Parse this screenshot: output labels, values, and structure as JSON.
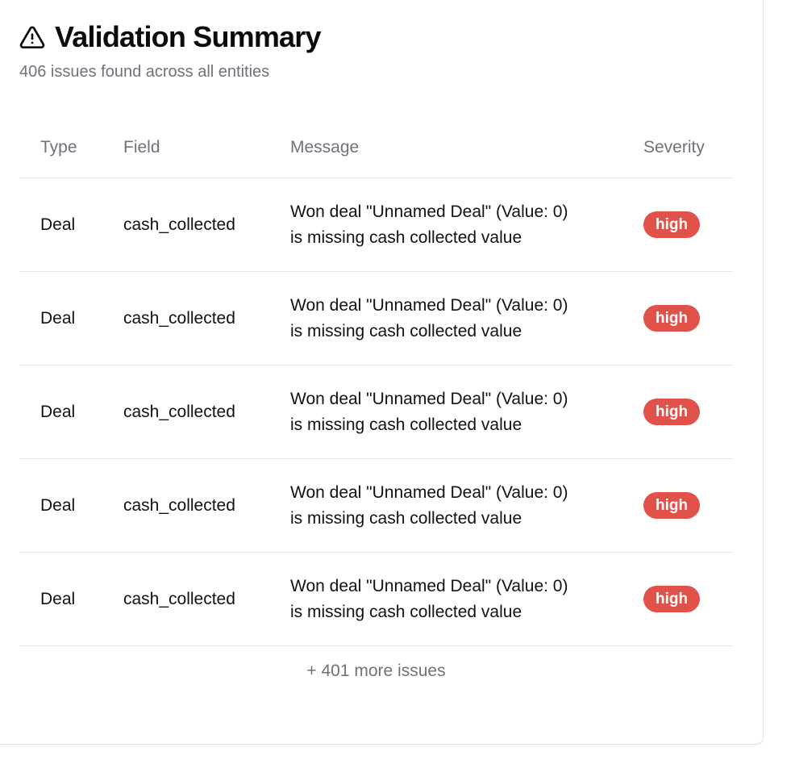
{
  "header": {
    "title": "Validation Summary",
    "icon": "warning-triangle-icon",
    "subtitle": "406 issues found across all entities"
  },
  "table": {
    "columns": [
      "Type",
      "Field",
      "Message",
      "Severity"
    ],
    "rows": [
      {
        "type": "Deal",
        "field": "cash_collected",
        "message_line1": "Won deal \"Unnamed Deal\" (Value: 0)",
        "message_line2": "is missing cash collected value",
        "severity": "high"
      },
      {
        "type": "Deal",
        "field": "cash_collected",
        "message_line1": "Won deal \"Unnamed Deal\" (Value: 0)",
        "message_line2": "is missing cash collected value",
        "severity": "high"
      },
      {
        "type": "Deal",
        "field": "cash_collected",
        "message_line1": "Won deal \"Unnamed Deal\" (Value: 0)",
        "message_line2": "is missing cash collected value",
        "severity": "high"
      },
      {
        "type": "Deal",
        "field": "cash_collected",
        "message_line1": "Won deal \"Unnamed Deal\" (Value: 0)",
        "message_line2": "is missing cash collected value",
        "severity": "high"
      },
      {
        "type": "Deal",
        "field": "cash_collected",
        "message_line1": "Won deal \"Unnamed Deal\" (Value: 0)",
        "message_line2": "is missing cash collected value",
        "severity": "high"
      }
    ]
  },
  "footer": {
    "more_text": "+ 401 more issues"
  },
  "colors": {
    "severity_high": "#e0514a",
    "muted_text": "#71717a",
    "border": "#e4e4e7"
  }
}
